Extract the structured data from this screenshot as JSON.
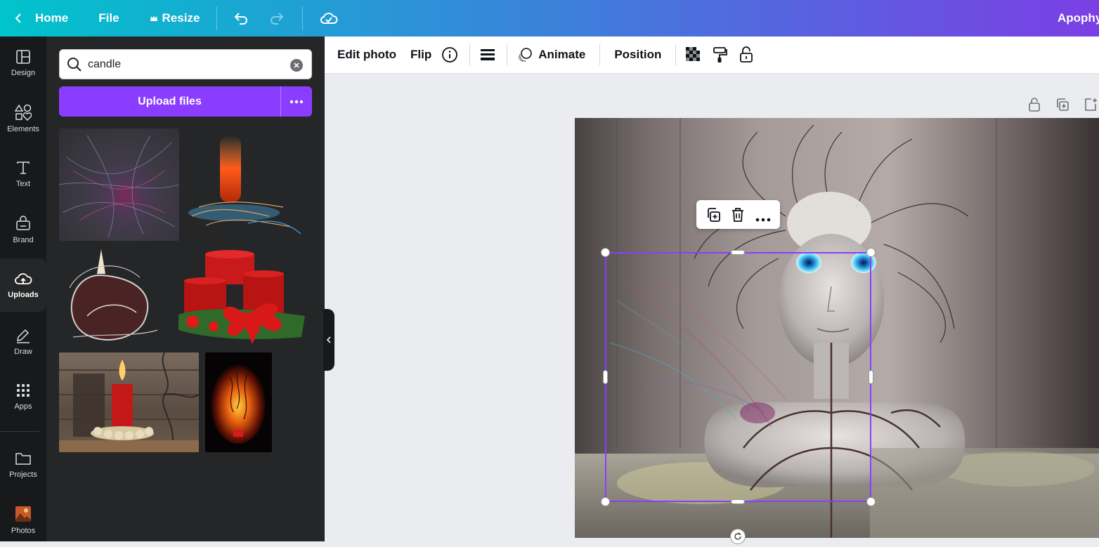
{
  "topbar": {
    "home": "Home",
    "file": "File",
    "resize": "Resize",
    "project_name": "Apophy"
  },
  "rail": [
    {
      "label": "Design",
      "icon": "design-icon"
    },
    {
      "label": "Elements",
      "icon": "elements-icon"
    },
    {
      "label": "Text",
      "icon": "text-icon"
    },
    {
      "label": "Brand",
      "icon": "brand-icon"
    },
    {
      "label": "Uploads",
      "icon": "cloud-upload-icon"
    },
    {
      "label": "Draw",
      "icon": "draw-icon"
    },
    {
      "label": "Apps",
      "icon": "apps-icon"
    },
    {
      "label": "Projects",
      "icon": "folder-icon"
    },
    {
      "label": "Photos",
      "icon": "photos-icon"
    }
  ],
  "panel": {
    "search_value": "candle",
    "upload_label": "Upload files"
  },
  "toolbar": {
    "edit_photo": "Edit photo",
    "flip": "Flip",
    "animate": "Animate",
    "position": "Position"
  },
  "colors": {
    "accent": "#8b3dff",
    "rail_bg": "#18191b",
    "panel_bg": "#252627"
  }
}
